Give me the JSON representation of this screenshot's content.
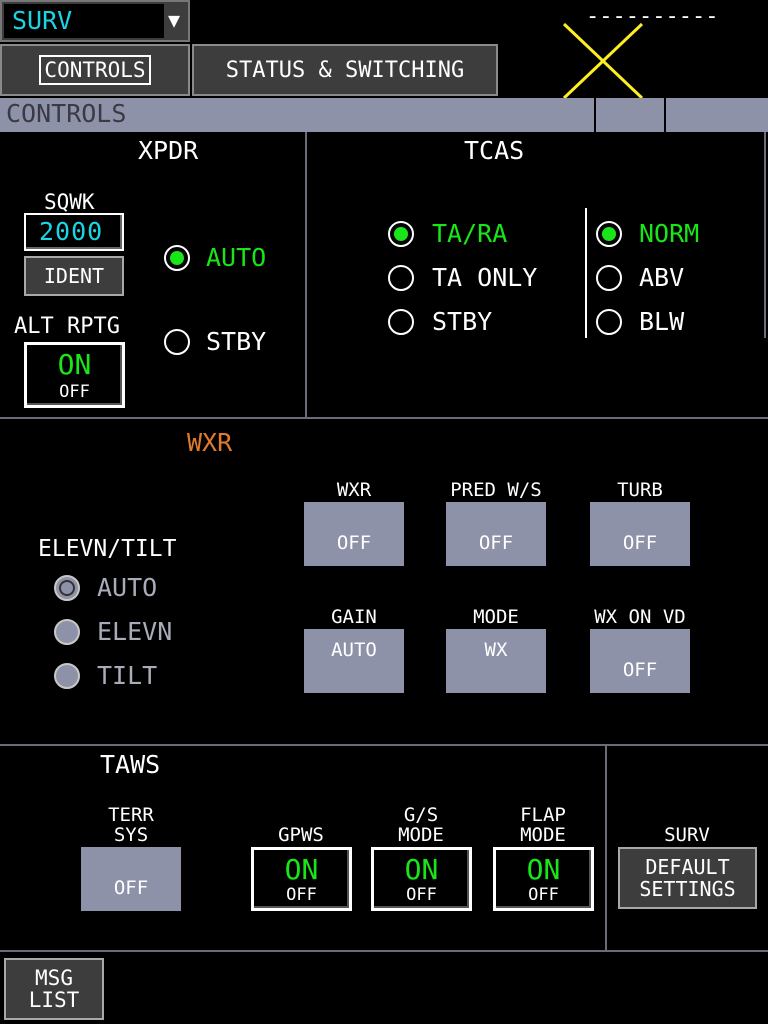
{
  "header": {
    "selector_value": "SURV",
    "selector_arrow": "▼",
    "dash_line": "----------"
  },
  "tabs": [
    {
      "label": "CONTROLS",
      "active": true
    },
    {
      "label": "STATUS & SWITCHING",
      "active": false
    }
  ],
  "section_bar": {
    "title": "CONTROLS"
  },
  "xpdr": {
    "title": "XPDR",
    "sqwk_label": "SQWK",
    "sqwk_value": "2000",
    "ident_label": "IDENT",
    "alt_rptg_label": "ALT RPTG",
    "alt_rptg_on": "ON",
    "alt_rptg_off": "OFF",
    "mode_options": [
      {
        "label": "AUTO",
        "selected": true
      },
      {
        "label": "STBY",
        "selected": false
      }
    ]
  },
  "tcas": {
    "title": "TCAS",
    "mode_options": [
      {
        "label": "TA/RA",
        "selected": true
      },
      {
        "label": "TA ONLY",
        "selected": false
      },
      {
        "label": "STBY",
        "selected": false
      }
    ],
    "range_options": [
      {
        "label": "NORM",
        "selected": true
      },
      {
        "label": "ABV",
        "selected": false
      },
      {
        "label": "BLW",
        "selected": false
      }
    ]
  },
  "wxr": {
    "title": "WXR",
    "elevn_tilt_label": "ELEVN/TILT",
    "elevn_options": [
      {
        "label": "AUTO",
        "selected": true
      },
      {
        "label": "ELEVN",
        "selected": false
      },
      {
        "label": "TILT",
        "selected": false
      }
    ],
    "buttons": [
      {
        "caption": "WXR",
        "value": "OFF"
      },
      {
        "caption": "PRED W/S",
        "value": "OFF"
      },
      {
        "caption": "TURB",
        "value": "OFF"
      },
      {
        "caption": "GAIN",
        "value": "AUTO"
      },
      {
        "caption": "MODE",
        "value": "WX"
      },
      {
        "caption": "WX ON VD",
        "value": "OFF"
      }
    ]
  },
  "taws": {
    "title": "TAWS",
    "terr_sys": {
      "caption_1": "TERR",
      "caption_2": "SYS",
      "value": "OFF"
    },
    "gpws": {
      "caption": "GPWS",
      "on": "ON",
      "off": "OFF"
    },
    "gs_mode": {
      "caption_1": "G/S",
      "caption_2": "MODE",
      "on": "ON",
      "off": "OFF"
    },
    "flap_mode": {
      "caption_1": "FLAP",
      "caption_2": "MODE",
      "on": "ON",
      "off": "OFF"
    }
  },
  "surv_defaults": {
    "caption": "SURV",
    "button_line1": "DEFAULT",
    "button_line2": "SETTINGS"
  },
  "footer": {
    "msg_list_line1": "MSG",
    "msg_list_line2": "LIST"
  },
  "colors": {
    "selected_green": "#19e619",
    "sqwk_cyan": "#19d6e6",
    "wxr_title_amber": "#e07a2c",
    "button_grey": "#8e92a8",
    "failure_cross_yellow": "#ffee22"
  }
}
